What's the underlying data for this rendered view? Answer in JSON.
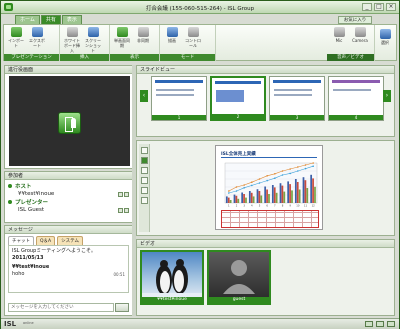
{
  "window": {
    "title": "打合会議 (155-060-515-264) - ISL Group",
    "buttons": [
      "_",
      "□",
      "×"
    ]
  },
  "ribbon": {
    "tabs": [
      "ホーム",
      "共有",
      "表示"
    ],
    "active_tab": "共有",
    "favorites_label": "お気に入り",
    "groups": [
      {
        "label": "プレゼンテーション",
        "buttons": [
          {
            "label": "インポート",
            "icon": "import-icon"
          },
          {
            "label": "エクスポート",
            "icon": "export-icon"
          }
        ]
      },
      {
        "label": "挿入",
        "buttons": [
          {
            "label": "ホワイトボード挿入",
            "icon": "whiteboard-icon"
          },
          {
            "label": "スクリーンショット",
            "icon": "screenshot-icon"
          }
        ]
      },
      {
        "label": "表示",
        "buttons": [
          {
            "label": "単画面同期",
            "icon": "sync-icon"
          },
          {
            "label": "非同期",
            "icon": "async-icon"
          }
        ]
      },
      {
        "label": "モード",
        "buttons": [
          {
            "label": "描画",
            "icon": "draw-icon"
          },
          {
            "label": "コントロール",
            "icon": "control-icon"
          }
        ]
      },
      {
        "label": "音声／ビデオ",
        "buttons": [
          {
            "label": "Mic",
            "icon": "mic-icon"
          },
          {
            "label": "Camera",
            "icon": "camera-icon"
          }
        ]
      }
    ],
    "extra_button": "選択"
  },
  "left": {
    "presenter_title": "進行役画面",
    "participants_title": "参加者",
    "participants": [
      {
        "role": "ホスト",
        "name": "¥¥test¥inoue"
      },
      {
        "role": "プレゼンター",
        "name": "ISL Guest"
      }
    ],
    "messages_title": "メッセージ",
    "chat_tabs": [
      "チャット",
      "Q＆A",
      "システム"
    ],
    "chat": {
      "greeting": "ISL Groupミーティングへようこそ。",
      "date": "2011/05/13",
      "sender": "¥¥test¥inoue",
      "text": "hoho",
      "time": "00:51"
    },
    "input_placeholder": "メッセージを入力してください"
  },
  "right": {
    "slideview_title": "スライドビュー",
    "thumb_numbers": [
      "1",
      "2",
      "3",
      "4"
    ],
    "selected_thumb": "2",
    "document_title": "ISL全体売上実績",
    "video_title": "ビデオ",
    "video_tiles": [
      {
        "name": "¥¥test¥inoue"
      },
      {
        "name": "guest"
      }
    ]
  },
  "chart_data": {
    "type": "bar",
    "categories": [
      "1",
      "2",
      "3",
      "4",
      "5",
      "6",
      "7",
      "8",
      "9",
      "10",
      "11",
      "12"
    ],
    "series": [
      {
        "values": [
          22,
          28,
          35,
          40,
          46,
          55,
          60,
          66,
          72,
          80,
          86,
          94
        ]
      },
      {
        "values": [
          18,
          24,
          30,
          34,
          40,
          45,
          52,
          58,
          63,
          70,
          76,
          82
        ]
      },
      {
        "values": [
          10,
          14,
          18,
          22,
          25,
          30,
          34,
          38,
          42,
          45,
          50,
          54
        ]
      }
    ],
    "lines": [
      {
        "values": [
          30,
          40,
          45,
          52,
          60,
          68,
          73,
          80,
          85,
          90,
          95,
          100
        ]
      },
      {
        "values": [
          25,
          30,
          38,
          44,
          50,
          56,
          62,
          70,
          74,
          80,
          86,
          92
        ]
      }
    ],
    "ylim": [
      0,
      100
    ],
    "colors": [
      "#3d5fa8",
      "#c94a3b",
      "#78a346"
    ]
  },
  "statusbar": {
    "logo": "ISL",
    "logo_sub": "online"
  }
}
